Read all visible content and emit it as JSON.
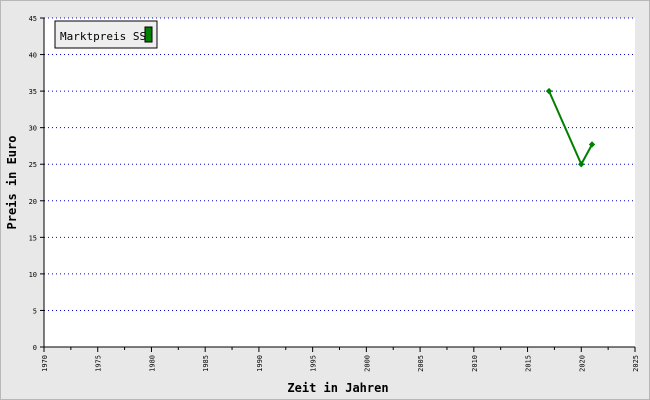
{
  "chart_data": {
    "type": "line",
    "title": "",
    "xlabel": "Zeit in Jahren",
    "ylabel": "Preis in Euro",
    "xlim": [
      1970,
      2025
    ],
    "ylim": [
      0,
      45
    ],
    "x_ticks": [
      "1970",
      "1975",
      "1980",
      "1985",
      "1990",
      "1995",
      "2000",
      "2005",
      "2010",
      "2015",
      "2020",
      "2025"
    ],
    "y_ticks": [
      "0",
      "5",
      "10",
      "15",
      "20",
      "25",
      "30",
      "35",
      "40",
      "45"
    ],
    "grid": "horizontal-dotted",
    "legend_position": "top-left",
    "series": [
      {
        "name": "Marktpreis SS",
        "color": "#008000",
        "points": [
          {
            "x": 2017,
            "y": 35
          },
          {
            "x": 2020,
            "y": 25
          },
          {
            "x": 2021,
            "y": 27.7
          }
        ]
      }
    ]
  },
  "colors": {
    "background": "#e8e8e8",
    "plot_area": "#ffffff",
    "grid": "#0000cc",
    "axis": "#000000"
  }
}
